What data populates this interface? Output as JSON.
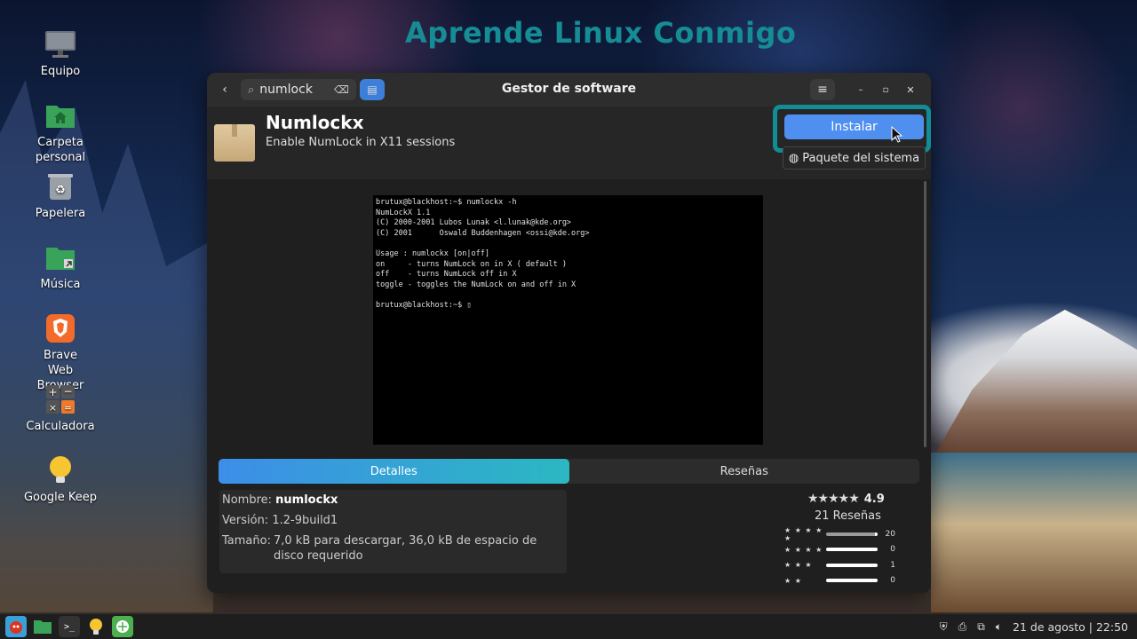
{
  "watermark": "Aprende Linux Conmigo",
  "desktop": {
    "icons": [
      {
        "label": "Equipo",
        "icon": "computer-icon"
      },
      {
        "label": "Carpeta personal",
        "icon": "home-folder-icon"
      },
      {
        "label": "Papelera",
        "icon": "trash-icon"
      },
      {
        "label": "Música",
        "icon": "music-folder-icon"
      },
      {
        "label": "Brave Web Browser",
        "icon": "brave-icon"
      },
      {
        "label": "Calculadora",
        "icon": "calculator-icon"
      },
      {
        "label": "Google Keep",
        "icon": "keep-icon"
      }
    ]
  },
  "window": {
    "title": "Gestor de software",
    "search_value": "numlock",
    "app": {
      "name": "Numlockx",
      "summary": "Enable NumLock in X11 sessions",
      "install_label": "Instalar",
      "package_label": "Paquete del sistema"
    },
    "screenshot_text": "brutux@blackhost:~$ numlockx -h\nNumLockX 1.1\n(C) 2000-2001 Lubos Lunak <l.lunak@kde.org>\n(C) 2001      Oswald Buddenhagen <ossi@kde.org>\n\nUsage : numlockx [on|off]\non     - turns NumLock on in X ( default )\noff    - turns NumLock off in X\ntoggle - toggles the NumLock on and off in X\n\nbrutux@blackhost:~$ ▯",
    "tabs": [
      "Detalles",
      "Reseñas"
    ],
    "details": {
      "name_key": "Nombre:",
      "name_val": "numlockx",
      "version_key": "Versión:",
      "version_val": "1.2-9build1",
      "size_key": "Tamaño:",
      "size_val": "7,0 kB para descargar, 36,0 kB de espacio de disco requerido"
    },
    "rating": {
      "stars": "★★★★★",
      "score": "4.9",
      "reviews": "21 Reseñas",
      "breakdown": [
        {
          "stars": "★ ★ ★ ★ ★",
          "count": "20",
          "fraction": 0.95
        },
        {
          "stars": "★ ★ ★ ★",
          "count": "0",
          "fraction": 0
        },
        {
          "stars": "★ ★ ★",
          "count": "1",
          "fraction": 0.05
        },
        {
          "stars": "★ ★",
          "count": "0",
          "fraction": 0
        }
      ]
    }
  },
  "taskbar": {
    "date": "21 de agosto",
    "time": "22:50",
    "separator": "|"
  }
}
